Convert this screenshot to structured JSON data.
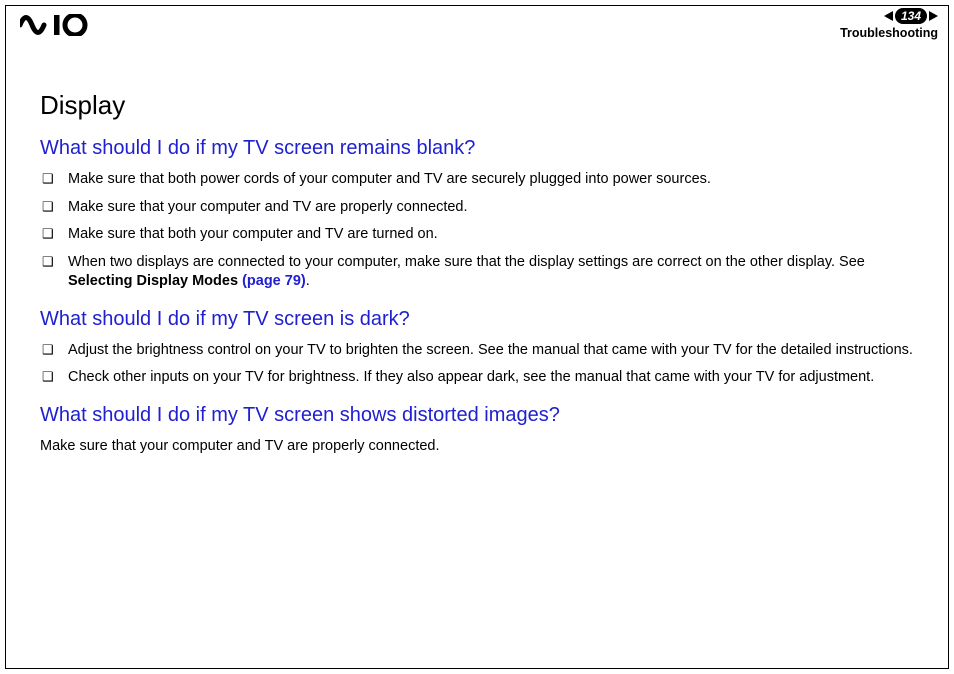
{
  "header": {
    "page_number": "134",
    "section": "Troubleshooting"
  },
  "content": {
    "title": "Display",
    "sections": [
      {
        "heading": "What should I do if my TV screen remains blank?",
        "type": "list",
        "items": [
          {
            "text": "Make sure that both power cords of your computer and TV are securely plugged into power sources."
          },
          {
            "text": "Make sure that your computer and TV are properly connected."
          },
          {
            "text": "Make sure that both your computer and TV are turned on."
          },
          {
            "text_prefix": "When two displays are connected to your computer, make sure that the display settings are correct on the other display. See ",
            "bold": "Selecting Display Modes ",
            "link": "(page 79)",
            "text_suffix": "."
          }
        ]
      },
      {
        "heading": "What should I do if my TV screen is dark?",
        "type": "list",
        "items": [
          {
            "text": "Adjust the brightness control on your TV to brighten the screen. See the manual that came with your TV for the detailed instructions."
          },
          {
            "text": "Check other inputs on your TV for brightness. If they also appear dark, see the manual that came with your TV for adjustment."
          }
        ]
      },
      {
        "heading": "What should I do if my TV screen shows distorted images?",
        "type": "plain",
        "text": "Make sure that your computer and TV are properly connected."
      }
    ]
  }
}
